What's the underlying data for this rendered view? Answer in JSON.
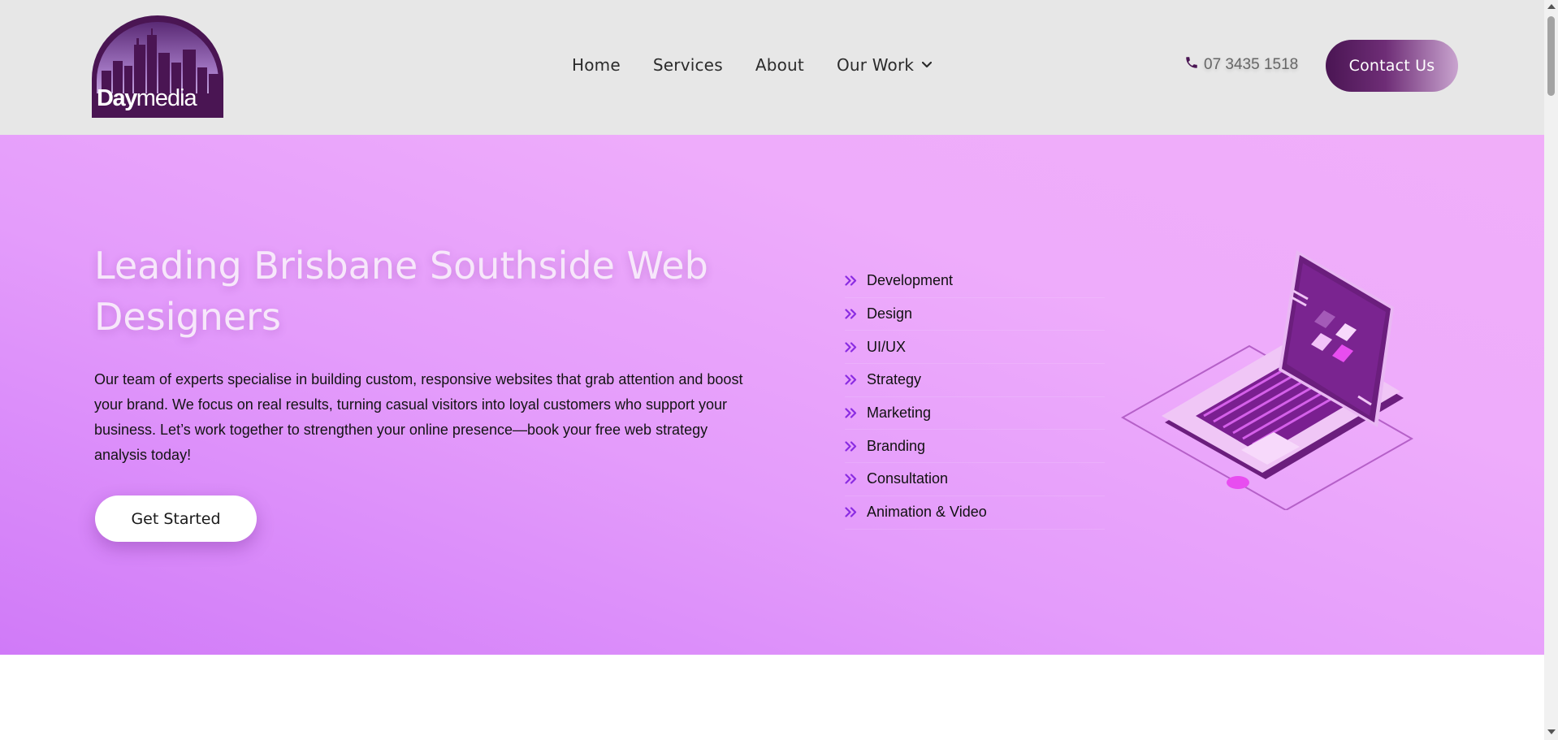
{
  "header": {
    "logo": {
      "text_bold": "Day",
      "text_light": "media",
      "icon": "city-skyline-logo"
    },
    "nav": [
      {
        "label": "Home"
      },
      {
        "label": "Services"
      },
      {
        "label": "About"
      },
      {
        "label": "Our Work",
        "icon": "chevron-down-icon"
      }
    ],
    "phone": {
      "icon": "phone-icon",
      "number": "07 3435 1518"
    },
    "contact_label": "Contact Us"
  },
  "hero": {
    "title": "Leading Brisbane Southside Web Designers",
    "description": "Our team of experts specialise in building custom, responsive websites that grab attention and boost your brand. We focus on real results, turning casual visitors into loyal customers who support your business. Let’s work together to strengthen your online presence—book your free web strategy analysis today!",
    "cta_label": "Get Started",
    "services": [
      "Development",
      "Design",
      "UI/UX",
      "Strategy",
      "Marketing",
      "Branding",
      "Consultation",
      "Animation & Video"
    ],
    "illustration": "isometric-laptop-illustration"
  },
  "colors": {
    "header_bg": "#e7e7e7",
    "brand_purple": "#4a1553",
    "hero_gradient_light": "#f0aef9",
    "hero_gradient_dark": "#d07af8",
    "bullet_icon": "#8a2be2"
  }
}
